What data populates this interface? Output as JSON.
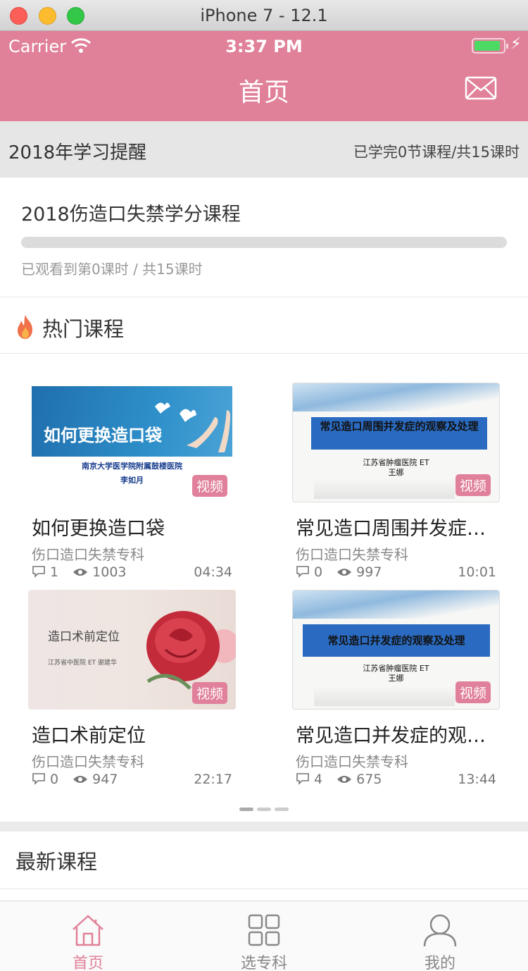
{
  "window": {
    "title": "iPhone 7 - 12.1"
  },
  "status": {
    "carrier": "Carrier",
    "time": "3:37 PM"
  },
  "nav": {
    "title": "首页"
  },
  "reminder": {
    "title": "2018年学习提醒",
    "summary": "已学完0节课程/共15课时"
  },
  "course": {
    "name": "2018伤造口失禁学分课程",
    "progress_text": "已观看到第0课时 / 共15课时",
    "progress_fraction": 0
  },
  "hot": {
    "title": "热门课程"
  },
  "cards": [
    {
      "title": "如何更换造口袋",
      "category": "伤口造口失禁专科",
      "comments": "1",
      "views": "1003",
      "duration": "04:34",
      "badge": "视频",
      "thumb": {
        "heading": "如何更换造口袋",
        "org": "南京大学医学院附属鼓楼医院",
        "author": "李如月"
      }
    },
    {
      "title": "常见造口周围并发症…",
      "category": "伤口造口失禁专科",
      "comments": "0",
      "views": "997",
      "duration": "10:01",
      "badge": "视频",
      "thumb": {
        "heading": "常见造口周围并发症的观察及处理",
        "org": "江苏省肿瘤医院 ET",
        "author": "王娜"
      }
    },
    {
      "title": "造口术前定位",
      "category": "伤口造口失禁专科",
      "comments": "0",
      "views": "947",
      "duration": "22:17",
      "badge": "视频",
      "thumb": {
        "heading": "造口术前定位",
        "org": "江苏省中医院 ET 谢建华",
        "author": ""
      }
    },
    {
      "title": "常见造口并发症的观…",
      "category": "伤口造口失禁专科",
      "comments": "4",
      "views": "675",
      "duration": "13:44",
      "badge": "视频",
      "thumb": {
        "heading": "常见造口并发症的观察及处理",
        "org": "江苏省肿瘤医院 ET",
        "author": "王娜"
      }
    }
  ],
  "latest": {
    "title": "最新课程"
  },
  "tabs": [
    {
      "label": "首页",
      "icon": "home-icon"
    },
    {
      "label": "选专科",
      "icon": "grid-icon"
    },
    {
      "label": "我的",
      "icon": "user-icon"
    }
  ],
  "colors": {
    "brand": "#e08199",
    "badge": "#e0809a"
  }
}
